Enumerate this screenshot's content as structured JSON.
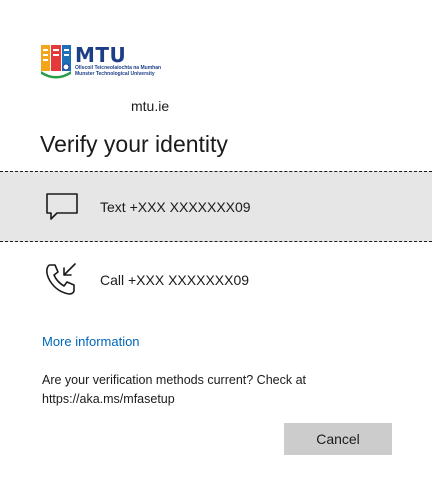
{
  "logo": {
    "title": "MTU",
    "subtitle_line1": "Ollscoil Teicneolaíochta na Mumhan",
    "subtitle_line2": "Munster Technological University"
  },
  "domain": "mtu.ie",
  "title": "Verify your identity",
  "options": [
    {
      "label": "Text +XXX XXXXXXX09",
      "icon": "message-icon"
    },
    {
      "label": "Call +XXX XXXXXXX09",
      "icon": "phone-call-icon"
    }
  ],
  "more_info": "More information",
  "note_line1": "Are your verification methods current? Check at",
  "note_line2": "https://aka.ms/mfasetup",
  "cancel_label": "Cancel",
  "colors": {
    "link": "#0067b8",
    "selected_bg": "#e6e6e6",
    "button_bg": "#cccccc",
    "brand_navy": "#1d3d86"
  }
}
